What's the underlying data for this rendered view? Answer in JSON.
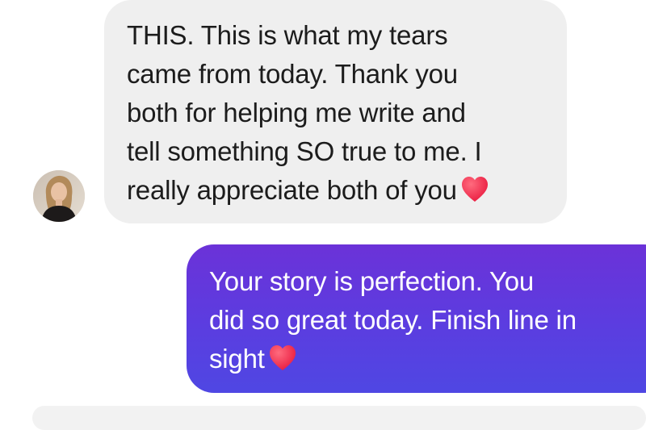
{
  "conversation": {
    "incoming_message": {
      "text": "THIS. This is what my tears\ncame from today. Thank you\nboth for helping me write and\ntell something SO true to me. I\nreally appreciate both of you",
      "emoji": "red-heart"
    },
    "outgoing_message": {
      "text": "Your story is perfection. You\ndid so great today. Finish line in\nsight",
      "emoji": "red-heart"
    }
  },
  "colors": {
    "incoming_bubble": "#efefef",
    "outgoing_bubble_top": "#6b32d8",
    "outgoing_bubble_bottom": "#4f47e3",
    "heart": "#f0284a"
  }
}
